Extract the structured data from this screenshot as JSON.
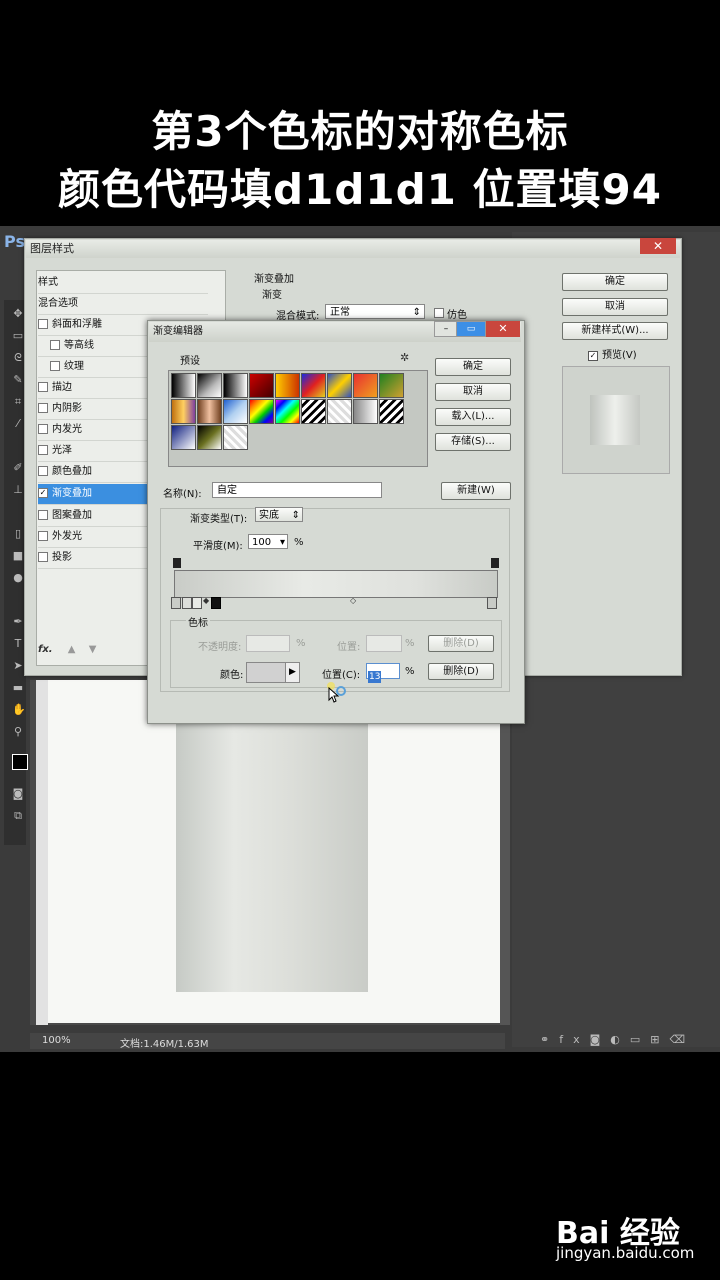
{
  "caption": {
    "line1": "第3个色标的对称色标",
    "line2": "颜色代码填d1d1d1  位置填94"
  },
  "app": {
    "logo": "Ps",
    "status_zoom": "100%",
    "status_doc": "文档:1.46M/1.63M"
  },
  "layer_style": {
    "title": "图层样式",
    "list": [
      {
        "label": "样式",
        "checkbox": false,
        "selected": false
      },
      {
        "label": "混合选项",
        "checkbox": false,
        "selected": false
      },
      {
        "label": "斜面和浮雕",
        "checkbox": true,
        "selected": false
      },
      {
        "label": "等高线",
        "checkbox": true,
        "selected": false
      },
      {
        "label": "纹理",
        "checkbox": true,
        "selected": false
      },
      {
        "label": "描边",
        "checkbox": true,
        "selected": false
      },
      {
        "label": "内阴影",
        "checkbox": true,
        "selected": false
      },
      {
        "label": "内发光",
        "checkbox": true,
        "selected": false
      },
      {
        "label": "光泽",
        "checkbox": true,
        "selected": false
      },
      {
        "label": "颜色叠加",
        "checkbox": true,
        "selected": false
      },
      {
        "label": "渐变叠加",
        "checkbox": true,
        "selected": true
      },
      {
        "label": "图案叠加",
        "checkbox": true,
        "selected": false
      },
      {
        "label": "外发光",
        "checkbox": true,
        "selected": false
      },
      {
        "label": "投影",
        "checkbox": true,
        "selected": false
      }
    ],
    "footer_fx": "fx.",
    "section_title": "渐变叠加",
    "section_sub": "渐变",
    "blend_label": "混合模式:",
    "blend_value": "正常",
    "dither_label": "仿色",
    "ok": "确定",
    "cancel": "取消",
    "new_style": "新建样式(W)...",
    "preview": "预览(V)"
  },
  "gradient_editor": {
    "title": "渐变编辑器",
    "presets_label": "预设",
    "ok": "确定",
    "cancel": "取消",
    "load": "载入(L)...",
    "save": "存储(S)...",
    "name_label": "名称(N):",
    "name_value": "自定",
    "new_button": "新建(W)",
    "type_label": "渐变类型(T):",
    "type_value": "实底",
    "smooth_label": "平滑度(M):",
    "smooth_value": "100",
    "smooth_unit": "%",
    "stops_label": "色标",
    "opacity_label": "不透明度:",
    "opacity_unit": "%",
    "opacity_pos_label": "位置:",
    "opacity_pos_unit": "%",
    "opacity_delete": "删除(D)",
    "color_label": "颜色:",
    "color_value": "#d1d1d1",
    "pos_label": "位置(C):",
    "pos_value": "13",
    "pos_unit": "%",
    "color_delete": "删除(D)"
  },
  "watermark": {
    "logo": "Bai 经验",
    "url": "jingyan.baidu.com"
  }
}
